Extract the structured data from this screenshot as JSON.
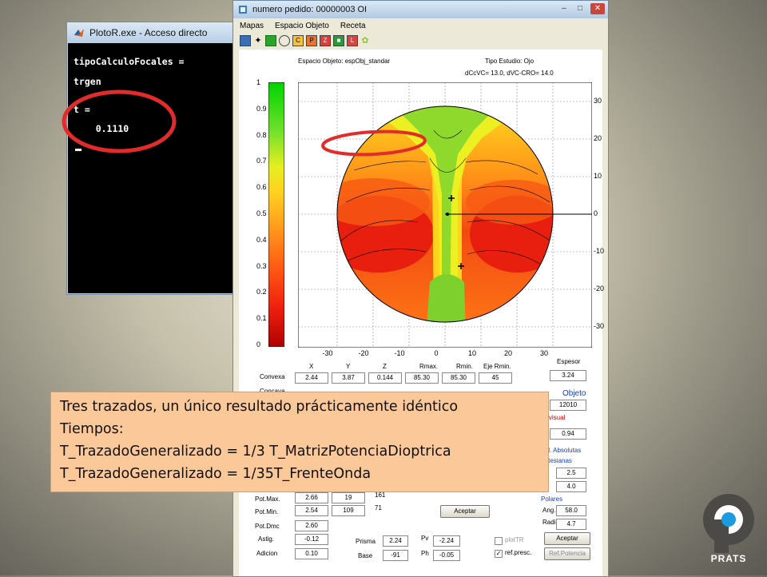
{
  "console": {
    "title": "PlotoR.exe - Acceso directo",
    "lines": [
      "tipoCalculoFocales =",
      "trgen",
      "t =",
      "    0.1110"
    ]
  },
  "main_window": {
    "title": "numero pedido:  00000003 OI",
    "menu": [
      "Mapas",
      "Espacio Objeto",
      "Receta"
    ],
    "toolbar_letters": [
      "C",
      "P",
      "Z",
      "L"
    ],
    "header": {
      "espacio_objeto": "Espacio Objeto:  espObj_standar",
      "tipo_estudio": "Tipo Estudio:   Ojo",
      "dcc": "dCcVC= 13.0, dVC-CRO= 14.0"
    },
    "colorbar_ticks": [
      "1",
      "0.9",
      "0.8",
      "0.7",
      "0.6",
      "0.5",
      "0.4",
      "0.3",
      "0.2",
      "0.1",
      "0"
    ],
    "map_x_ticks": [
      "-30",
      "-20",
      "-10",
      "0",
      "10",
      "20",
      "30"
    ],
    "map_y_ticks": [
      "30",
      "20",
      "10",
      "0",
      "-10",
      "-20",
      "-30"
    ],
    "columns": [
      "X",
      "Y",
      "Z",
      "Rmax.",
      "Rmin.",
      "Eje Rmin."
    ],
    "rows": [
      {
        "label": "Convexa",
        "values": [
          "2.44",
          "3.87",
          "0.144",
          "85.30",
          "85.30",
          "45"
        ]
      },
      {
        "label": "Concava",
        "values": [
          "",
          "",
          "",
          "",
          "",
          ""
        ]
      }
    ],
    "espesor_label": "Espesor",
    "espesor_value": "3.24",
    "objeto_label": "Objeto",
    "objeto_value": "12010",
    "agvisual_label": "agvisual",
    "agvisual_value": "0.94",
    "absolutas_label": "rd. Absolutas",
    "cartesianas_label": "artesianas",
    "cart_values": [
      "2.5",
      "4.0"
    ],
    "polares_label": "Polares",
    "ang_label": "Ang.",
    "ang_value": "58.0",
    "radio_label": "Radio",
    "radio_value": "4.7",
    "pot_max_label": "Pot.Max.",
    "pot_max": [
      "2.66",
      "19"
    ],
    "pot_min_label": "Pot.Min.",
    "pot_min": [
      "2.54",
      "109"
    ],
    "pot_dmc_label": "Pot.Dmc",
    "pot_dmc": "2.60",
    "astig_label": "Astig.",
    "astig": "-0.12",
    "adicion_label": "Adicion",
    "adicion": "0.10",
    "side_numbers": [
      "161",
      "71"
    ],
    "aceptar_label": "Aceptar",
    "aceptar2_label": "Aceptar",
    "prisma_label": "Prisma",
    "prisma_value": "2.24",
    "base_label": "Base",
    "base_value": "-91",
    "pv_label": "Pv",
    "pv_value": "-2.24",
    "ph_label": "Ph",
    "ph_value": "-0.05",
    "plottr_label": "plotTR",
    "refpresc_label": "ref.presc.",
    "refpotencia_label": "Ref.Potencia"
  },
  "caption": {
    "lines": [
      "Tres trazados, un único resultado prácticamente idéntico",
      "Tiempos:",
      "T_TrazadoGeneralizado = 1/3  T_MatrizPotenciaDioptrica",
      "T_TrazadoGeneralizado = 1/35T_FrenteOnda"
    ]
  },
  "logo": {
    "text": "PRATS"
  },
  "colors": {
    "highlight_ring": "#e32b2b",
    "caption_bg": "#fbc89a",
    "logo_dark": "#4b4a46",
    "logo_blue": "#1e9be0"
  }
}
